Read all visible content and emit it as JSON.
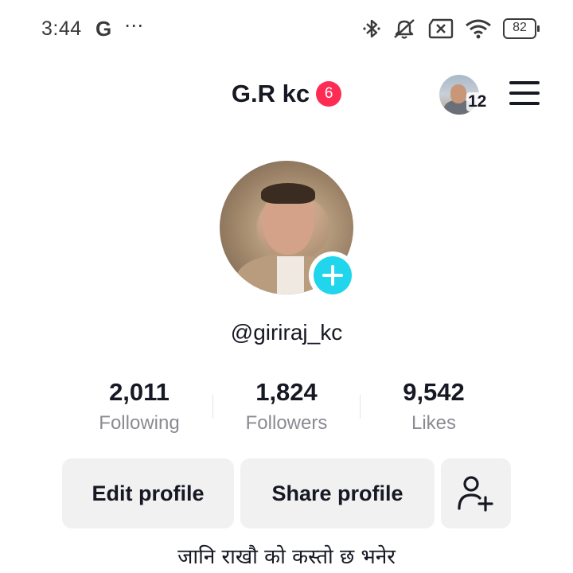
{
  "status_bar": {
    "time": "3:44",
    "g_label": "G",
    "dots": "⋯",
    "battery": "82",
    "icons": [
      "bluetooth-icon",
      "silent-icon",
      "no-sim-icon",
      "wifi-icon",
      "battery-icon"
    ]
  },
  "header": {
    "title": "G.R kc",
    "notification_count": "6",
    "story_count": "12",
    "menu_icon": "hamburger-menu-icon"
  },
  "profile": {
    "username": "@giriraj_kc",
    "stats": [
      {
        "value": "2,011",
        "label": "Following"
      },
      {
        "value": "1,824",
        "label": "Followers"
      },
      {
        "value": "9,542",
        "label": "Likes"
      }
    ],
    "buttons": {
      "edit": "Edit profile",
      "share": "Share profile",
      "add_friend_icon": "add-friend-icon"
    },
    "bio": "जानि राखौ को कस्तो छ भनेर"
  },
  "colors": {
    "accent_badge": "#fe2c55",
    "add_button": "#20d5ec",
    "button_bg": "#f1f1f2",
    "secondary_text": "#8a8b91"
  }
}
